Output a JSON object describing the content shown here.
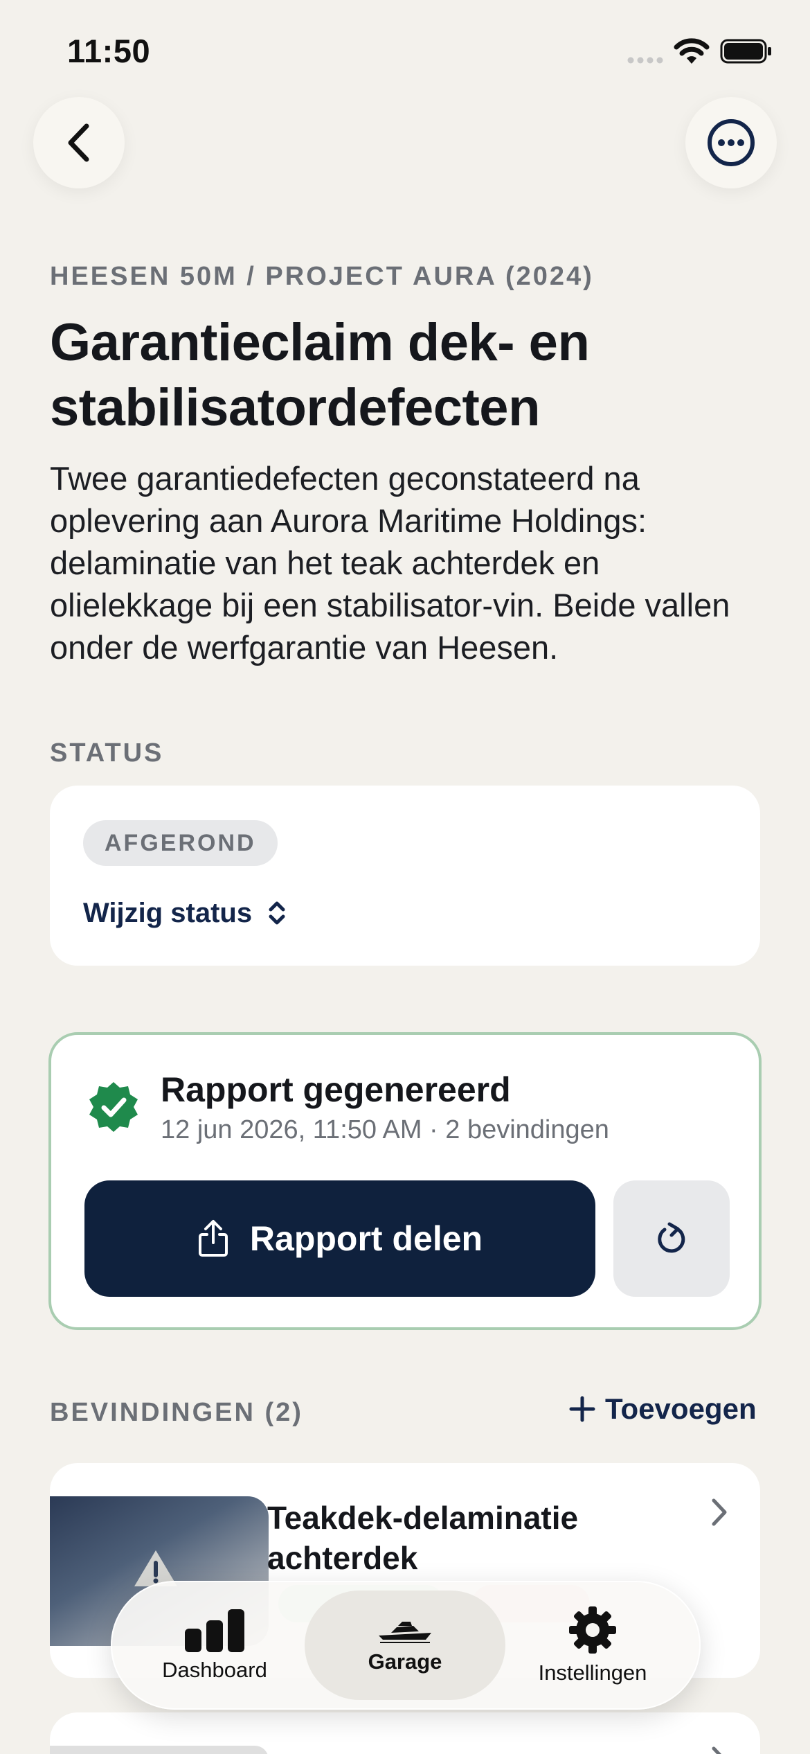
{
  "status_bar": {
    "time": "11:50"
  },
  "header": {
    "back_icon": "chevron-left-icon",
    "more_icon": "ellipsis-circle-icon"
  },
  "kicker": "HEESEN 50M / PROJECT AURA (2024)",
  "title": "Garantieclaim dek- en stabilisatordefecten",
  "description": "Twee garantiedefecten geconstateerd na oplevering aan Aurora Maritime Holdings: delaminatie van het teak achterdek en olielekkage bij een stabilisator-vin. Beide vallen onder de werfgarantie van Heesen.",
  "status_section": {
    "label": "STATUS",
    "current": "AFGEROND",
    "change_label": "Wijzig status"
  },
  "report": {
    "title": "Rapport gegenereerd",
    "meta": "12 jun 2026, 11:50 AM · 2 bevindingen",
    "share_label": "Rapport delen",
    "colors": {
      "badge": "#1f8a4c",
      "button": "#0f213d",
      "border": "#a9cdb1"
    }
  },
  "findings": {
    "label": "BEVINDINGEN (2)",
    "add_label": "Toevoegen",
    "items": [
      {
        "title": "Teakdek-delaminatie achterdek"
      }
    ]
  },
  "tabbar": {
    "active": "Garage",
    "tabs": [
      {
        "label": "Dashboard",
        "icon": "bar-chart-icon"
      },
      {
        "label": "Garage",
        "icon": "yacht-icon"
      },
      {
        "label": "Instellingen",
        "icon": "gear-icon"
      }
    ]
  }
}
